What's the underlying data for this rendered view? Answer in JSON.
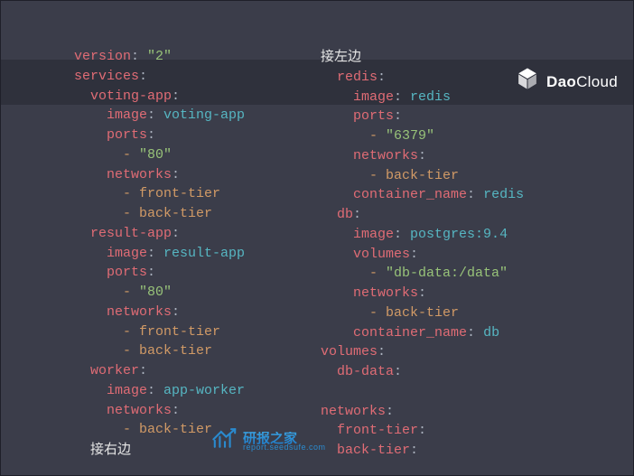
{
  "brand": {
    "bold": "Dao",
    "thin": "Cloud"
  },
  "watermark": {
    "main": "研报之家",
    "sub": "report.seedsufe.com"
  },
  "left_note": "接右边",
  "right_note": "接左边",
  "yaml": {
    "version_key": "version",
    "version_val": "\"2\"",
    "services_key": "services",
    "voting": {
      "name": "voting-app",
      "image_key": "image",
      "image_val": "voting-app",
      "ports_key": "ports",
      "ports": [
        "\"80\""
      ],
      "networks_key": "networks",
      "networks": [
        "front-tier",
        "back-tier"
      ]
    },
    "result": {
      "name": "result-app",
      "image_key": "image",
      "image_val": "result-app",
      "ports_key": "ports",
      "ports": [
        "\"80\""
      ],
      "networks_key": "networks",
      "networks": [
        "front-tier",
        "back-tier"
      ]
    },
    "worker": {
      "name": "worker",
      "image_key": "image",
      "image_val": "app-worker",
      "networks_key": "networks",
      "networks": [
        "back-tier"
      ]
    },
    "redis": {
      "name": "redis",
      "image_key": "image",
      "image_val": "redis",
      "ports_key": "ports",
      "ports": [
        "\"6379\""
      ],
      "networks_key": "networks",
      "networks": [
        "back-tier"
      ],
      "cname_key": "container_name",
      "cname_val": "redis"
    },
    "db": {
      "name": "db",
      "image_key": "image",
      "image_val": "postgres:9.4",
      "volumes_key": "volumes",
      "volumes": [
        "\"db-data:/data\""
      ],
      "networks_key": "networks",
      "networks": [
        "back-tier"
      ],
      "cname_key": "container_name",
      "cname_val": "db"
    },
    "volumes_key": "volumes",
    "volumes_entry": "db-data",
    "networks_key": "networks",
    "networks": [
      "front-tier",
      "back-tier"
    ]
  }
}
